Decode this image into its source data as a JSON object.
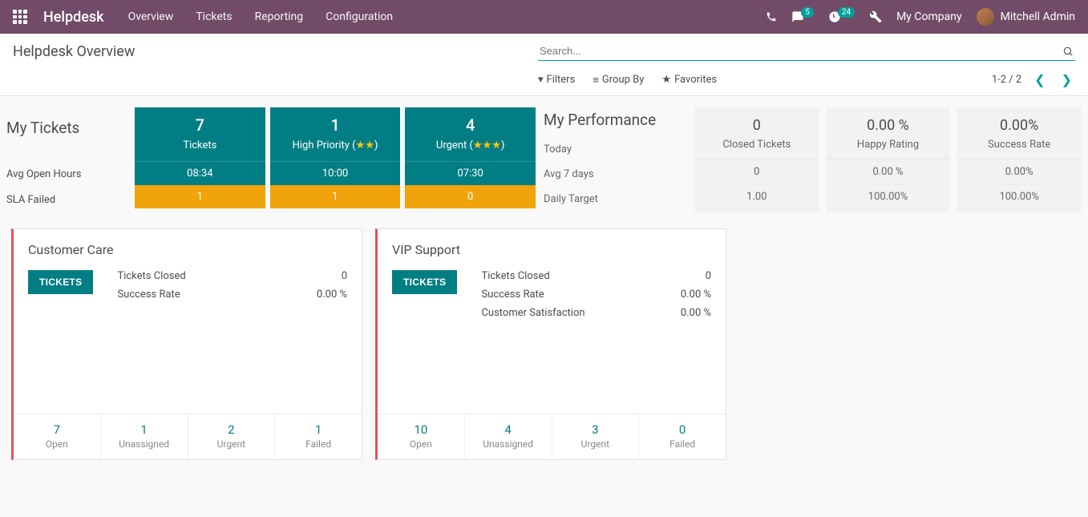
{
  "nav": {
    "brand": "Helpdesk",
    "menu": [
      "Overview",
      "Tickets",
      "Reporting",
      "Configuration"
    ],
    "chat_badge": "5",
    "activity_badge": "24",
    "company": "My Company",
    "user": "Mitchell Admin"
  },
  "control": {
    "title": "Helpdesk Overview",
    "search_placeholder": "Search...",
    "filters": "Filters",
    "groupby": "Group By",
    "favorites": "Favorites",
    "pager": "1-2 / 2"
  },
  "mytickets": {
    "title": "My Tickets",
    "row_avg": "Avg Open Hours",
    "row_sla": "SLA Failed",
    "cols": [
      {
        "num": "7",
        "label": "Tickets",
        "stars": 0,
        "avg": "08:34",
        "sla": "1"
      },
      {
        "num": "1",
        "label": "High Priority",
        "stars": 2,
        "avg": "10:00",
        "sla": "1"
      },
      {
        "num": "4",
        "label": "Urgent",
        "stars": 3,
        "avg": "07:30",
        "sla": "0"
      }
    ]
  },
  "perf": {
    "title": "My Performance",
    "row_today": "Today",
    "row_avg7": "Avg 7 days",
    "row_target": "Daily Target",
    "cols": [
      {
        "num": "0",
        "label": "Closed Tickets",
        "avg7": "0",
        "target": "1.00"
      },
      {
        "num": "0.00 %",
        "label": "Happy Rating",
        "avg7": "0.00 %",
        "target": "100.00%"
      },
      {
        "num": "0.00%",
        "label": "Success Rate",
        "avg7": "0.00%",
        "target": "100.00%"
      }
    ]
  },
  "kanban": [
    {
      "title": "Customer Care",
      "btn": "TICKETS",
      "stats": [
        {
          "label": "Tickets Closed",
          "value": "0"
        },
        {
          "label": "Success Rate",
          "value": "0.00 %"
        }
      ],
      "footer": [
        {
          "num": "7",
          "label": "Open"
        },
        {
          "num": "1",
          "label": "Unassigned"
        },
        {
          "num": "2",
          "label": "Urgent"
        },
        {
          "num": "1",
          "label": "Failed"
        }
      ]
    },
    {
      "title": "VIP Support",
      "btn": "TICKETS",
      "stats": [
        {
          "label": "Tickets Closed",
          "value": "0"
        },
        {
          "label": "Success Rate",
          "value": "0.00 %"
        },
        {
          "label": "Customer Satisfaction",
          "value": "0.00 %"
        }
      ],
      "footer": [
        {
          "num": "10",
          "label": "Open"
        },
        {
          "num": "4",
          "label": "Unassigned"
        },
        {
          "num": "3",
          "label": "Urgent"
        },
        {
          "num": "0",
          "label": "Failed"
        }
      ]
    }
  ]
}
